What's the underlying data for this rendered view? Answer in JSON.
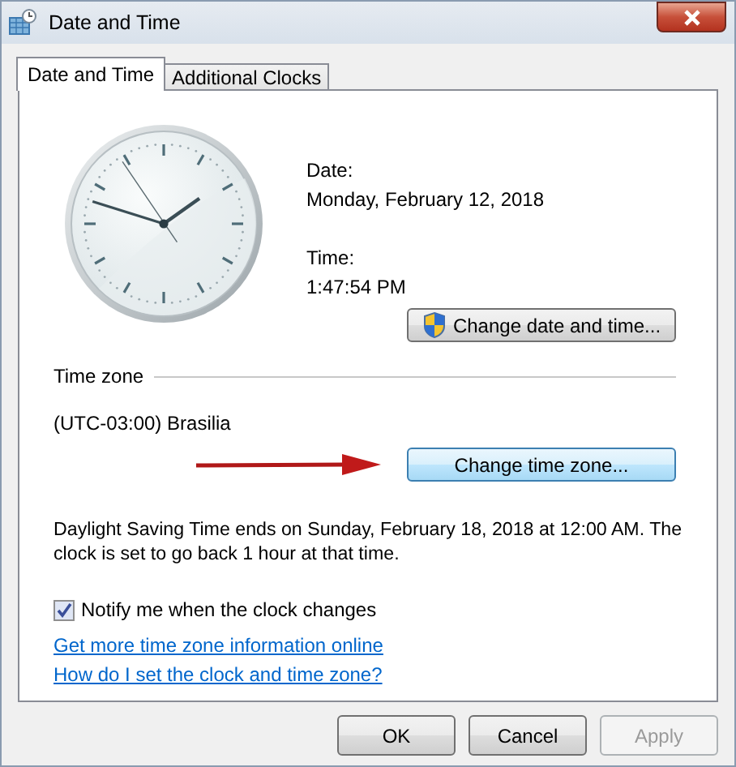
{
  "window": {
    "title": "Date and Time"
  },
  "tabs": [
    {
      "label": "Date and Time",
      "selected": true
    },
    {
      "label": "Additional Clocks",
      "selected": false
    }
  ],
  "date": {
    "label": "Date:",
    "value": "Monday, February 12, 2018"
  },
  "time": {
    "label": "Time:",
    "value": "1:47:54 PM"
  },
  "change_date_button": {
    "label": "Change date and time..."
  },
  "time_zone": {
    "heading": "Time zone",
    "value": "(UTC-03:00) Brasilia",
    "button": "Change time zone..."
  },
  "dst_note": "Daylight Saving Time ends on Sunday, February 18, 2018 at 12:00 AM. The clock is set to go back 1 hour at that time.",
  "notify": {
    "label": "Notify me when the clock changes",
    "checked": true
  },
  "links": [
    "Get more time zone information online",
    "How do I set the clock and time zone?"
  ],
  "buttons": [
    {
      "label": "OK",
      "disabled": false
    },
    {
      "label": "Cancel",
      "disabled": false
    },
    {
      "label": "Apply",
      "disabled": true
    }
  ]
}
